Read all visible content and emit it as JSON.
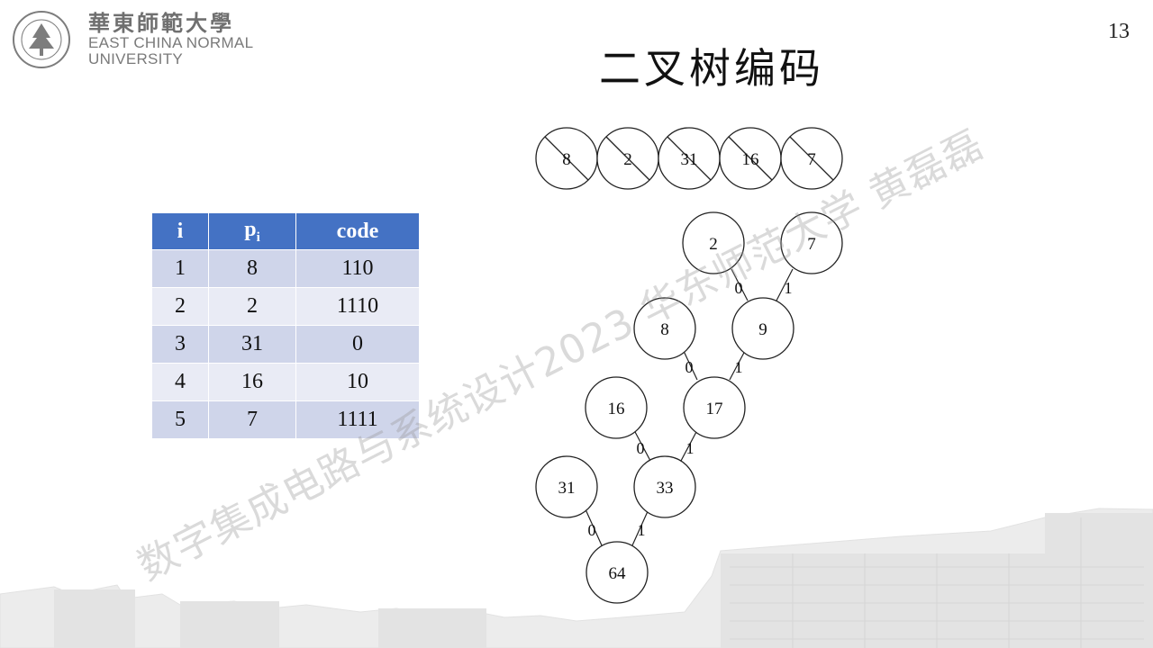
{
  "header": {
    "logo_cn": "華東師範大學",
    "logo_en_line1": "EAST CHINA NORMAL",
    "logo_en_line2": "UNIVERSITY",
    "title": "二叉树编码",
    "page_number": "13"
  },
  "table": {
    "headers": [
      "i",
      "p",
      "code"
    ],
    "header_sub": "i",
    "rows": [
      [
        "1",
        "8",
        "110"
      ],
      [
        "2",
        "2",
        "1110"
      ],
      [
        "3",
        "31",
        "0"
      ],
      [
        "4",
        "16",
        "10"
      ],
      [
        "5",
        "7",
        "1111"
      ]
    ]
  },
  "tree": {
    "crossed_nodes": [
      "8",
      "2",
      "31",
      "16",
      "7"
    ],
    "nodes": [
      "2",
      "7",
      "8",
      "9",
      "16",
      "17",
      "31",
      "33",
      "64"
    ],
    "edge_labels": [
      "0",
      "1",
      "0",
      "1",
      "0",
      "1",
      "0",
      "1"
    ]
  },
  "watermark": "数字集成电路与系统设计2023 华东师范大学 黄磊磊",
  "colors": {
    "table_header": "#4472c4",
    "row_odd": "#cfd5ea",
    "row_even": "#e9ebf5"
  }
}
